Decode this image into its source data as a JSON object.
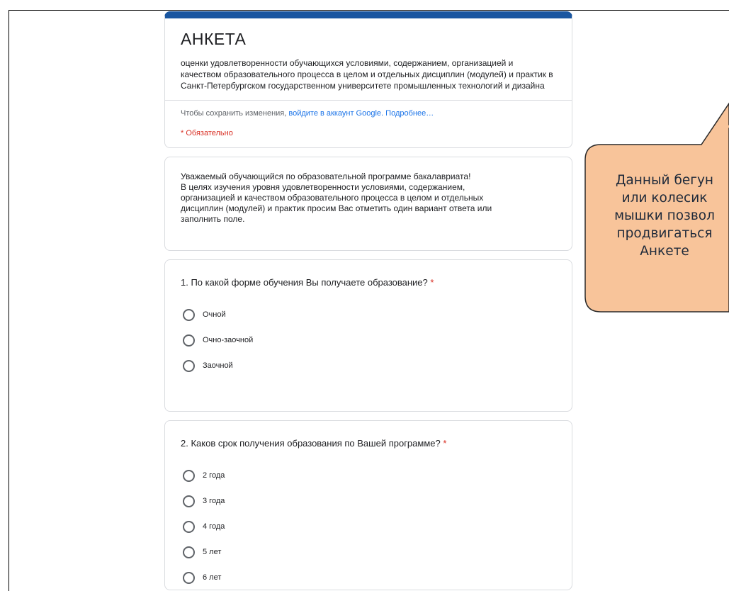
{
  "form": {
    "title": "АНКЕТА",
    "description": "оценки удовлетворенности обучающихся условиями, содержанием, организацией и качеством образовательного процесса в целом и отдельных дисциплин (модулей) и практик в Санкт-Петербургском государственном университете промышленных технологий и дизайна",
    "signin_prefix": "Чтобы сохранить изменения, ",
    "signin_link": "войдите в аккаунт Google.",
    "more_link": "Подробнее…",
    "required_note": "* Обязательно"
  },
  "intro": {
    "lines": [
      "Уважаемый обучающийся по образовательной программе бакалавриата!",
      "В целях изучения уровня удовлетворенности условиями, содержанием,",
      "организацией и качеством образовательного процесса в целом и отдельных",
      "дисциплин (модулей) и практик просим Вас отметить один вариант ответа или",
      "заполнить поле."
    ]
  },
  "questions": [
    {
      "title": "1. По какой форме обучения Вы получаете образование?",
      "required_mark": "*",
      "options": [
        "Очной",
        "Очно-заочной",
        "Заочной"
      ]
    },
    {
      "title": "2. Каков срок получения образования по Вашей программе?",
      "required_mark": "*",
      "options": [
        "2 года",
        "3 года",
        "4 года",
        "5 лет",
        "6 лет"
      ]
    }
  ],
  "callout": {
    "lines": [
      "Данный бегун",
      "или колесик",
      "мышки позвол",
      "продвигаться",
      "Анкете"
    ]
  },
  "colors": {
    "header_bar": "#1a56a0",
    "link": "#1a73e8",
    "required": "#d93025",
    "callout_fill": "#f8c49a"
  }
}
